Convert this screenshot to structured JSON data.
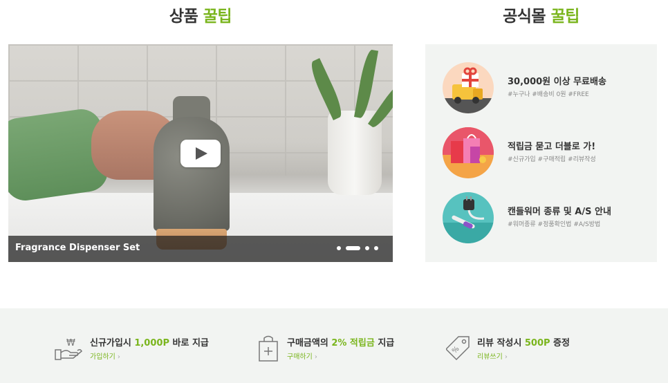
{
  "sections": {
    "product_tips": {
      "prefix": "상품",
      "accent": "꿀팁"
    },
    "mall_tips": {
      "prefix": "공식몰",
      "accent": "꿀팁"
    }
  },
  "video": {
    "caption": "Fragrance Dispenser Set",
    "slide_count": 4,
    "active_slide": 2
  },
  "tips": [
    {
      "title": "30,000원 이상 무료배송",
      "tags": "#누구나 #배송비 0원 #FREE",
      "icon": "delivery-gift-icon"
    },
    {
      "title": "적립금 묻고 더블로 가!",
      "tags": "#신규가입 #구매적립 #리뷰작성",
      "icon": "shopping-bags-icon"
    },
    {
      "title": "캔들워머 종류 및 A/S 안내",
      "tags": "#워머종류 #정품확인법 #A/S방법",
      "icon": "warmer-plug-icon"
    }
  ],
  "benefits": [
    {
      "pre": "신규가입시 ",
      "highlight": "1,000P",
      "post": " 바로 지급",
      "link": "가입하기",
      "icon": "hand-won-icon"
    },
    {
      "pre": "구매금액의 ",
      "highlight": "2% 적립금",
      "post": " 지급",
      "link": "구매하기",
      "icon": "shopping-bag-plus-icon"
    },
    {
      "pre": "리뷰 작성시 ",
      "highlight": "500P",
      "post": " 증정",
      "link": "리뷰쓰기",
      "icon": "price-tag-icon"
    }
  ],
  "colors": {
    "accent": "#7ab51d",
    "panel_bg": "#f2f4f2",
    "text": "#333333"
  }
}
